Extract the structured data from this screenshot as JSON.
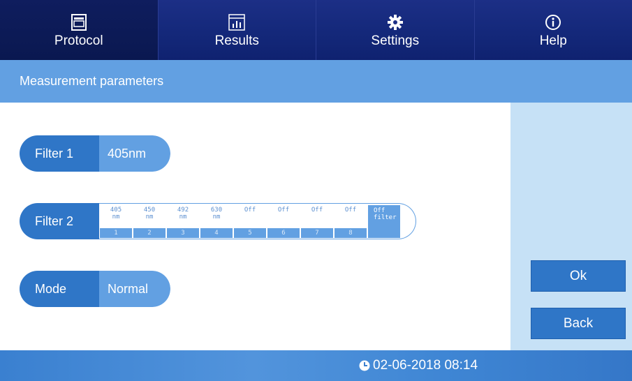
{
  "nav": {
    "tabs": [
      {
        "label": "Protocol",
        "icon": "protocol-icon"
      },
      {
        "label": "Results",
        "icon": "results-chart-icon"
      },
      {
        "label": "Settings",
        "icon": "gear-icon"
      },
      {
        "label": "Help",
        "icon": "info-icon"
      }
    ],
    "active": "Protocol"
  },
  "header": {
    "title": "Measurement parameters"
  },
  "params": {
    "filter1": {
      "label": "Filter 1",
      "value": "405nm"
    },
    "filter2": {
      "label": "Filter 2",
      "options": [
        {
          "line1": "405",
          "line2": "nm",
          "num": "1"
        },
        {
          "line1": "450",
          "line2": "nm",
          "num": "2"
        },
        {
          "line1": "492",
          "line2": "nm",
          "num": "3"
        },
        {
          "line1": "630",
          "line2": "nm",
          "num": "4"
        },
        {
          "line1": "Off",
          "line2": "",
          "num": "5"
        },
        {
          "line1": "Off",
          "line2": "",
          "num": "6"
        },
        {
          "line1": "Off",
          "line2": "",
          "num": "7"
        },
        {
          "line1": "Off",
          "line2": "",
          "num": "8"
        }
      ],
      "selected": {
        "line1": "Off",
        "line2": "filter"
      }
    },
    "mode": {
      "label": "Mode",
      "value": "Normal"
    }
  },
  "buttons": {
    "ok": "Ok",
    "back": "Back"
  },
  "footer": {
    "datetime": "02-06-2018 08:14"
  },
  "colors": {
    "nav": "#1c2f86",
    "accent": "#62a0e2",
    "dark_accent": "#2f76c7",
    "panel": "#c6e1f6"
  }
}
